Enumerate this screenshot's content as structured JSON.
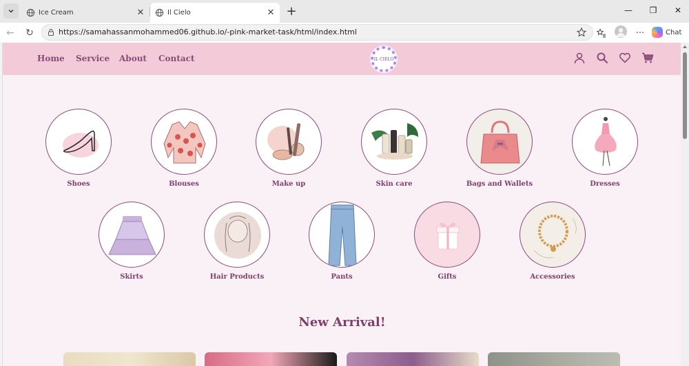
{
  "browser": {
    "tabs": [
      {
        "label": "Ice Cream",
        "active": false
      },
      {
        "label": "Il Cielo",
        "active": true
      }
    ],
    "url": "https://samahassanmohammed06.github.io/-pink-market-task/html/index.html",
    "chat_label": "Chat"
  },
  "site": {
    "nav": [
      "Home",
      "Service",
      "About",
      "Contact"
    ],
    "logo_text": "IL CIELO",
    "header_icons": [
      "user-icon",
      "search-icon",
      "heart-icon",
      "cart-icon"
    ],
    "categories_row1": [
      "Shoes",
      "Blouses",
      "Make up",
      "Skin care",
      "Bags and Wallets",
      "Dresses"
    ],
    "categories_row2": [
      "Skirts",
      "Hair Products",
      "Pants",
      "Gifts",
      "Accessories"
    ],
    "section_title": "New Arrival!",
    "colors": {
      "header_bg": "#f3cbd8",
      "page_bg": "#f9f1f6",
      "accent": "#7e3f6b",
      "circle_border": "#8e4a7c"
    }
  }
}
